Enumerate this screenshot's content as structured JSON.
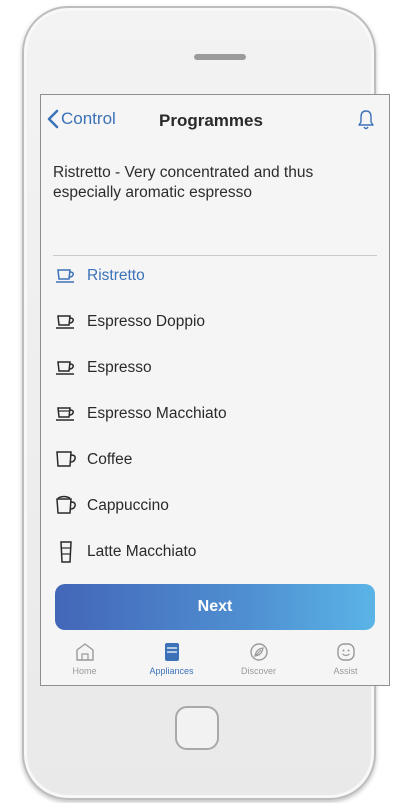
{
  "nav": {
    "back_label": "Control",
    "title": "Programmes"
  },
  "description": "Ristretto - Very concentrated and thus especially aromatic espresso",
  "programmes": [
    {
      "label": "Ristretto",
      "icon": "small-cup-icon",
      "selected": true
    },
    {
      "label": "Espresso Doppio",
      "icon": "espresso-cup-icon",
      "selected": false
    },
    {
      "label": "Espresso",
      "icon": "espresso-cup-icon",
      "selected": false
    },
    {
      "label": "Espresso Macchiato",
      "icon": "macchiato-cup-icon",
      "selected": false
    },
    {
      "label": "Coffee",
      "icon": "coffee-cup-icon",
      "selected": false
    },
    {
      "label": "Cappuccino",
      "icon": "cappuccino-cup-icon",
      "selected": false
    },
    {
      "label": "Latte Macchiato",
      "icon": "latte-glass-icon",
      "selected": false
    }
  ],
  "next_label": "Next",
  "tabs": [
    {
      "label": "Home",
      "icon": "home-icon",
      "active": false
    },
    {
      "label": "Appliances",
      "icon": "appliances-icon",
      "active": true
    },
    {
      "label": "Discover",
      "icon": "discover-icon",
      "active": false
    },
    {
      "label": "Assist",
      "icon": "assist-icon",
      "active": false
    }
  ],
  "colors": {
    "accent": "#3c72b8",
    "text": "#2a2a2a",
    "button_gradient_start": "#4366b8",
    "button_gradient_end": "#5ab4e6"
  }
}
